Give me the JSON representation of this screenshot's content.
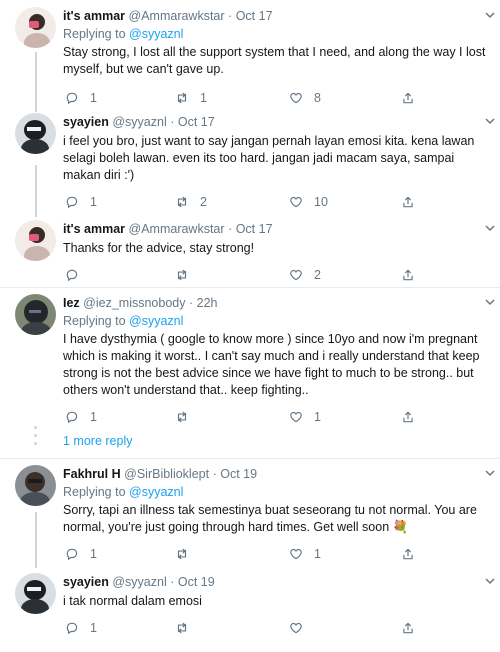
{
  "replying_prefix": "Replying to",
  "tweets": [
    {
      "name": "it's ammar",
      "handle": "@Ammarawkstar",
      "date": "Oct 17",
      "replying_to": "@syyaznl",
      "text": "Stay strong, I lost all the support system that I need, and along the way I lost myself, but we can't gave up.",
      "replies": "1",
      "retweets": "1",
      "likes": "8"
    },
    {
      "name": "syayien",
      "handle": "@syyaznl",
      "date": "Oct 17",
      "text": "i feel you bro, just want to say jangan pernah layan emosi kita. kena lawan selagi boleh lawan. even its too hard. jangan jadi macam saya, sampai makan diri :')",
      "replies": "1",
      "retweets": "2",
      "likes": "10"
    },
    {
      "name": "it's ammar",
      "handle": "@Ammarawkstar",
      "date": "Oct 17",
      "text": "Thanks for the advice, stay strong!",
      "replies": "",
      "retweets": "",
      "likes": "2"
    },
    {
      "name": "Iez",
      "handle": "@iez_missnobody",
      "date": "22h",
      "replying_to": "@syyaznl",
      "text": "I have dysthymia ( google to know more ) since 10yo and now i'm pregnant which is making it worst.. I can't say much and i really understand that keep strong is not the best advice since we have fight to much to be strong.. but others won't understand that.. keep fighting..",
      "replies": "1",
      "retweets": "",
      "likes": "1"
    },
    {
      "name": "Fakhrul H",
      "handle": "@SirBiblioklept",
      "date": "Oct 19",
      "replying_to": "@syyaznl",
      "text": "Sorry, tapi an illness tak semestinya buat seseorang tu not normal. You are normal, you're just going through hard times. Get well soon 💐",
      "replies": "1",
      "retweets": "",
      "likes": "1"
    },
    {
      "name": "syayien",
      "handle": "@syyaznl",
      "date": "Oct 19",
      "text": "i tak normal dalam emosi",
      "replies": "1",
      "retweets": "",
      "likes": ""
    }
  ],
  "more_replies": "1 more reply",
  "colors": {
    "link": "#1da1f2",
    "muted": "#657786",
    "divider": "#e6ecf0",
    "thread": "#ccd6dd"
  }
}
